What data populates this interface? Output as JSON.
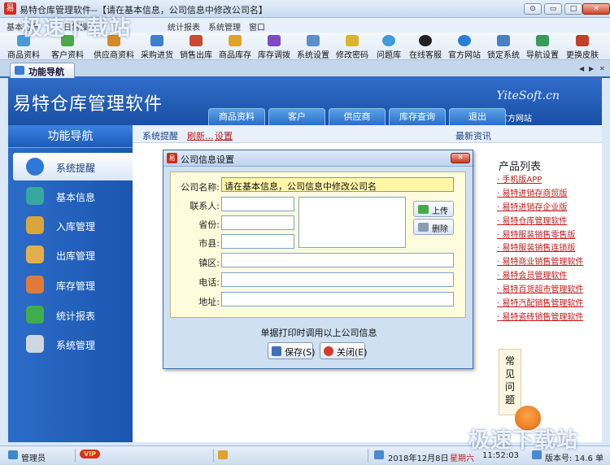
{
  "window": {
    "title": "易特仓库管理软件--【请在基本信息，公司信息中修改公司名】",
    "controls": [
      "⊙",
      "▭",
      "□",
      "✕"
    ]
  },
  "menu": [
    "基本信息",
    "日常操作",
    "统计报表",
    "系统管理",
    "窗口"
  ],
  "toolbar": [
    {
      "label": "商品资料",
      "icon": "goods-icon",
      "color": "#4a9ad8"
    },
    {
      "label": "客户资料",
      "icon": "customers-icon",
      "color": "#4aa84a"
    },
    {
      "label": "供应商资料",
      "icon": "supplier-icon",
      "color": "#d58b2a"
    },
    {
      "label": "采购进货",
      "icon": "purchase-icon",
      "color": "#3f7fd0"
    },
    {
      "label": "销售出库",
      "icon": "sales-icon",
      "color": "#c94a32"
    },
    {
      "label": "商品库存",
      "icon": "inventory-icon",
      "color": "#e0a22a"
    },
    {
      "label": "库存调拨",
      "icon": "transfer-icon",
      "color": "#7e4ac0"
    },
    {
      "label": "系统设置",
      "icon": "settings-icon",
      "color": "#5b8fc9"
    },
    {
      "label": "修改密码",
      "icon": "password-icon",
      "color": "#d8b52a"
    },
    {
      "label": "问题库",
      "icon": "faq-icon",
      "color": "#3f9ad8"
    },
    {
      "label": "在线客服",
      "icon": "service-icon",
      "color": "#222222"
    },
    {
      "label": "官方网站",
      "icon": "website-icon",
      "color": "#2a7fd5"
    },
    {
      "label": "锁定系统",
      "icon": "lock-icon",
      "color": "#4a7fc0"
    },
    {
      "label": "导航设置",
      "icon": "nav-settings-icon",
      "color": "#3a9a5a"
    },
    {
      "label": "更换皮肤",
      "icon": "skin-icon",
      "color": "#c0402a"
    }
  ],
  "tab": {
    "label": "功能导航"
  },
  "banner": {
    "brand": "易特仓库管理软件",
    "domain": "YiteSoft.cn",
    "site_link": "官方网站",
    "nav_tabs": [
      "商品资料",
      "客户",
      "供应商",
      "库存查询",
      "退出"
    ]
  },
  "sidebar": {
    "header": "功能导航",
    "items": [
      {
        "label": "系统提醒",
        "icon": "info-icon",
        "color": "#2f78d8",
        "active": true
      },
      {
        "label": "基本信息",
        "icon": "basic-info-icon",
        "color": "#3aa6a0"
      },
      {
        "label": "入库管理",
        "icon": "stock-in-icon",
        "color": "#d7a53a"
      },
      {
        "label": "出库管理",
        "icon": "stock-out-icon",
        "color": "#e2b04a"
      },
      {
        "label": "库存管理",
        "icon": "warehouse-icon",
        "color": "#e07a3a"
      },
      {
        "label": "统计报表",
        "icon": "chart-icon",
        "color": "#3fae4a"
      },
      {
        "label": "系统管理",
        "icon": "tools-icon",
        "color": "#d0d6de"
      }
    ]
  },
  "content": {
    "tabs": [
      "系统提醒",
      "刷新...",
      "设置"
    ],
    "latest_news": "最新资讯",
    "products_title": "产品列表",
    "products": [
      "手机版APP",
      "易特进销存商贸版",
      "易特进销存企业版",
      "易特仓库管理软件",
      "易特服装销售零售版",
      "易特服装销售连锁版",
      "易特商业销售管理软件",
      "易特会员管理软件",
      "易特百货超市管理软件",
      "易特汽配销售管理软件",
      "易特瓷砖销售管理软件"
    ],
    "faq": [
      "常",
      "见",
      "问",
      "题"
    ]
  },
  "dialog": {
    "title": "公司信息设置",
    "company_label": "公司名称:",
    "company_value": "请在基本信息，公司信息中修改公司名",
    "contact_label": "联系人:",
    "province_label": "省份:",
    "city_label": "市县:",
    "district_label": "镇区:",
    "phone_label": "电话:",
    "address_label": "地址:",
    "upload_label": "上传",
    "delete_label": "删除",
    "note": "单据打印时调用以上公司信息",
    "save_label": "保存(S)",
    "close_label": "关闭(E)"
  },
  "status": {
    "user": "管理员",
    "vip": "VIP",
    "date": "2018年12月8日",
    "weekday": "星期六",
    "time": "11:52:03",
    "version": "版本号: 14.6 单"
  },
  "watermark": "极速下载站"
}
